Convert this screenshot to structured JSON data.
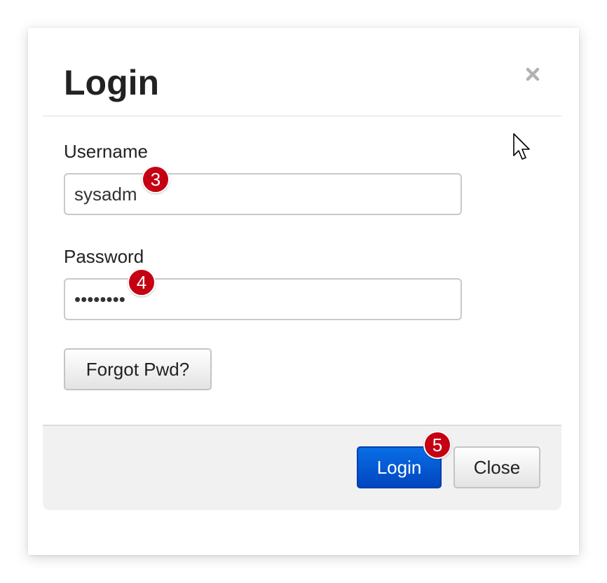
{
  "dialog": {
    "title": "Login",
    "close_icon": "close-icon"
  },
  "form": {
    "username": {
      "label": "Username",
      "value": "sysadm"
    },
    "password": {
      "label": "Password",
      "value": "••••••••"
    },
    "forgot_label": "Forgot Pwd?"
  },
  "footer": {
    "login_label": "Login",
    "close_label": "Close"
  },
  "step_badges": {
    "username": "3",
    "password": "4",
    "login": "5"
  },
  "colors": {
    "primary": "#0055d4",
    "badge": "#c40012",
    "text": "#222222"
  }
}
